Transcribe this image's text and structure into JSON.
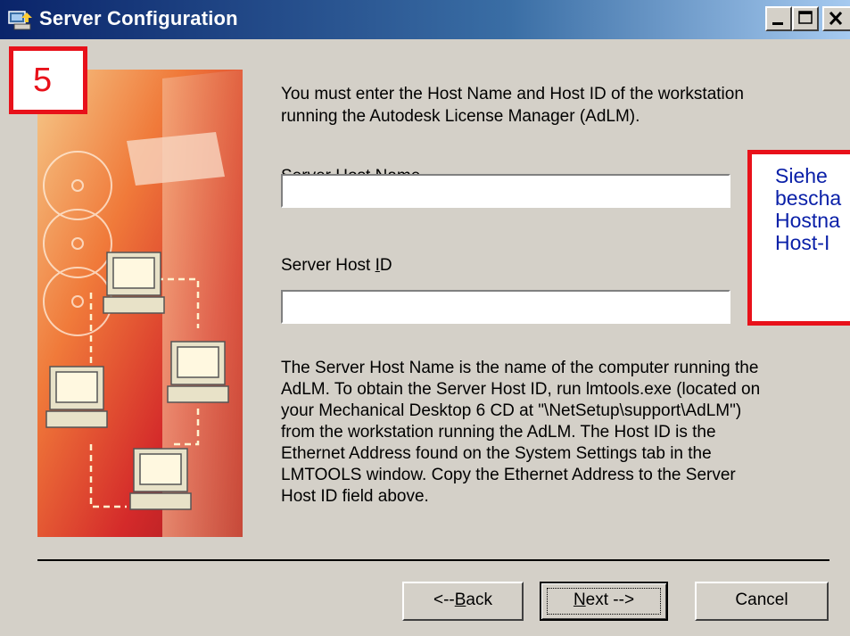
{
  "window": {
    "title": "Server Configuration"
  },
  "badge": {
    "number": "5"
  },
  "intro_lines": [
    "You must enter the Host Name and Host ID of the workstation",
    "running the Autodesk License Manager (AdLM)."
  ],
  "fields": {
    "host_name": {
      "label_pre": "Server Host N",
      "label_ul": "a",
      "label_post": "me",
      "value": ""
    },
    "host_id": {
      "label_pre": "Server Host ",
      "label_ul": "I",
      "label_post": "D",
      "value": ""
    }
  },
  "note_lines": [
    "Siehe",
    "bescha",
    "Hostna",
    "Host-I"
  ],
  "description_lines": [
    "The Server Host Name is the name of the computer running the",
    "AdLM. To obtain the Server Host ID, run lmtools.exe (located on",
    "your Mechanical Desktop 6 CD at \"\\NetSetup\\support\\AdLM\")",
    "from the workstation running the AdLM. The Host ID is the",
    "Ethernet Address found on the System Settings tab in the",
    "LMTOOLS window. Copy the Ethernet Address to the Server",
    "Host ID field above."
  ],
  "buttons": {
    "back": {
      "pre": "<--",
      "ul": "B",
      "post": "ack"
    },
    "next": {
      "pre": "",
      "ul": "N",
      "post": "ext -->"
    },
    "cancel": "Cancel"
  },
  "colors": {
    "title_bar": "#0a246a",
    "highlight_red": "#e8111a",
    "note_text": "#0a20a8"
  }
}
